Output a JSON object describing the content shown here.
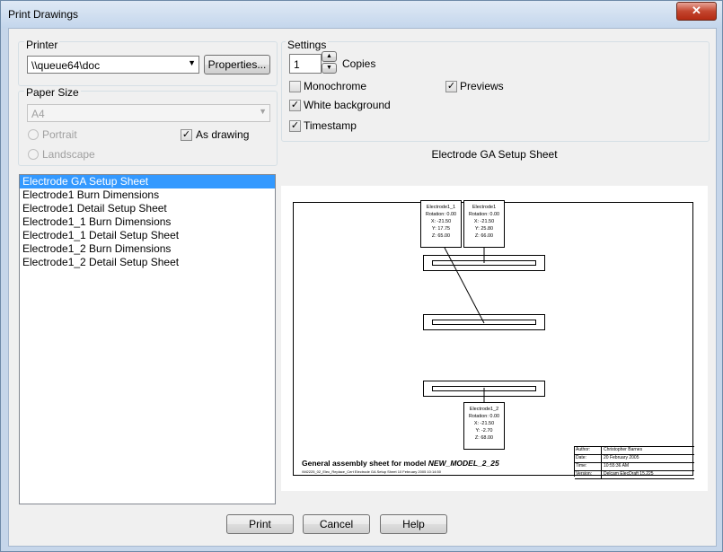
{
  "window": {
    "title": "Print Drawings",
    "close_glyph": "✕"
  },
  "printer": {
    "group_label": "Printer",
    "selected": "\\\\queue64\\doc",
    "properties_label": "Properties..."
  },
  "paper": {
    "group_label": "Paper Size",
    "size": "A4",
    "portrait_label": "Portrait",
    "landscape_label": "Landscape",
    "as_drawing_label": "As drawing",
    "as_drawing_checked": true
  },
  "settings": {
    "group_label": "Settings",
    "copies": "1",
    "copies_label": "Copies",
    "monochrome_label": "Monochrome",
    "monochrome_checked": false,
    "previews_label": "Previews",
    "previews_checked": true,
    "white_bg_label": "White background",
    "white_bg_checked": true,
    "timestamp_label": "Timestamp",
    "timestamp_checked": true
  },
  "drawings": [
    "Electrode GA Setup Sheet",
    "Electrode1 Burn Dimensions",
    "Electrode1 Detail Setup Sheet",
    "Electrode1_1 Burn Dimensions",
    "Electrode1_1 Detail Setup Sheet",
    "Electrode1_2 Burn Dimensions",
    "Electrode1_2 Detail Setup Sheet"
  ],
  "preview": {
    "title": "Electrode GA Setup Sheet",
    "cards": [
      {
        "name": "Electrode1_1",
        "rotation": "Rotation: 0.00",
        "x": "X: -21.50",
        "y": "Y: 17.75",
        "z": "Z: 65.00"
      },
      {
        "name": "Electrode1",
        "rotation": "Rotation: 0.00",
        "x": "X: -21.50",
        "y": "Y: 25.80",
        "z": "Z: 66.00"
      },
      {
        "name": "Electrode1_2",
        "rotation": "Rotation: 0.00",
        "x": "X: -21.50",
        "y": "Y: -2.70",
        "z": "Z: 68.00"
      }
    ],
    "sheet_title": "General assembly sheet for model",
    "model_name": "NEW_MODEL_2_25",
    "sheet_subtitle": "\\\\M2225_02_Elec_Replace_Cert Electrode GA Setup Sheet 10 February 2005 10:14:50",
    "title_block": [
      {
        "label": "Author:",
        "value": "Christopher Barnes"
      },
      {
        "label": "Date:",
        "value": "20 February 2005"
      },
      {
        "label": "Time:",
        "value": "10:55:36 AM"
      },
      {
        "label": "Version:",
        "value": "Delcam ElecDraft 15.225"
      }
    ]
  },
  "buttons": {
    "print": "Print",
    "cancel": "Cancel",
    "help": "Help"
  }
}
